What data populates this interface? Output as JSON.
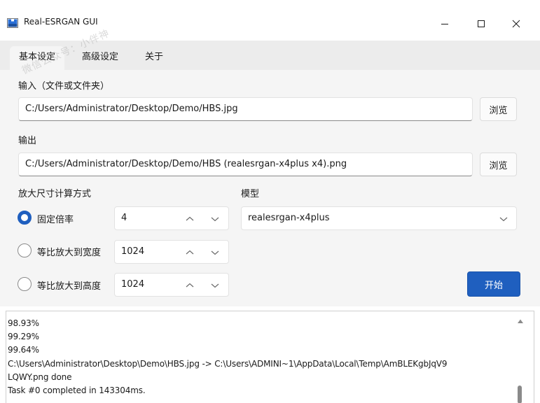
{
  "window": {
    "title": "Real-ESRGAN GUI",
    "accent_color": "#1f5fbf"
  },
  "tabs": [
    {
      "label": "基本设定",
      "active": true
    },
    {
      "label": "高级设定",
      "active": false
    },
    {
      "label": "关于",
      "active": false
    }
  ],
  "input": {
    "label": "输入（文件或文件夹）",
    "value": "C:/Users/Administrator/Desktop/Demo/HBS.jpg",
    "browse_label": "浏览"
  },
  "output": {
    "label": "输出",
    "value": "C:/Users/Administrator/Desktop/Demo/HBS (realesrgan-x4plus x4).png",
    "browse_label": "浏览"
  },
  "scale": {
    "label": "放大尺寸计算方式",
    "options": [
      {
        "label": "固定倍率",
        "checked": true,
        "value": "4"
      },
      {
        "label": "等比放大到宽度",
        "checked": false,
        "value": "1024"
      },
      {
        "label": "等比放大到高度",
        "checked": false,
        "value": "1024"
      }
    ]
  },
  "model": {
    "label": "模型",
    "value": "realesrgan-x4plus"
  },
  "start_label": "开始",
  "log": {
    "lines": [
      "98.93%",
      "99.29%",
      "99.64%",
      "C:\\Users\\Administrator\\Desktop\\Demo\\HBS.jpg -> C:\\Users\\ADMINI~1\\AppData\\Local\\Temp\\AmBLEKgbJqV9",
      "LQWY.png done",
      "Task #0 completed in 143304ms."
    ]
  },
  "watermark": "微信公众号：小伴神"
}
